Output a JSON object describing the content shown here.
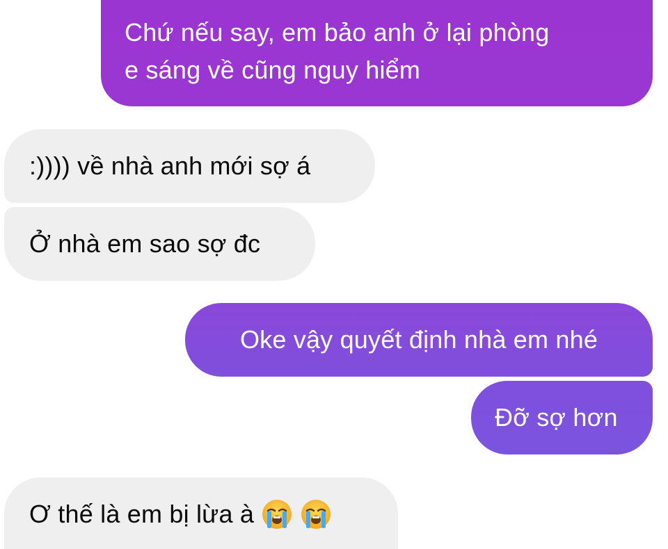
{
  "conversation": {
    "messages": [
      {
        "direction": "outgoing",
        "lines": [
          "Chứ nếu say,  em bảo anh ở lại phòng",
          "e sáng về cũng nguy hiểm"
        ]
      },
      {
        "direction": "incoming",
        "text": ":)))) về nhà anh mới sợ á"
      },
      {
        "direction": "incoming",
        "text": "Ở nhà em sao sợ đc"
      },
      {
        "direction": "outgoing",
        "text": "Oke vậy quyết định nhà em nhé"
      },
      {
        "direction": "outgoing",
        "text": "Đỡ sợ hơn"
      },
      {
        "direction": "incoming",
        "text": "Ơ thế là em bị lừa à",
        "emojis": [
          "loudly-crying-face-icon",
          "loudly-crying-face-icon"
        ]
      }
    ]
  },
  "colors": {
    "outgoing_bubble_top": "#9b35d1",
    "outgoing_bubble_bottom": "#7a54de",
    "incoming_bubble": "#efefef",
    "outgoing_text": "#ffffff",
    "incoming_text": "#0a0a0a"
  }
}
